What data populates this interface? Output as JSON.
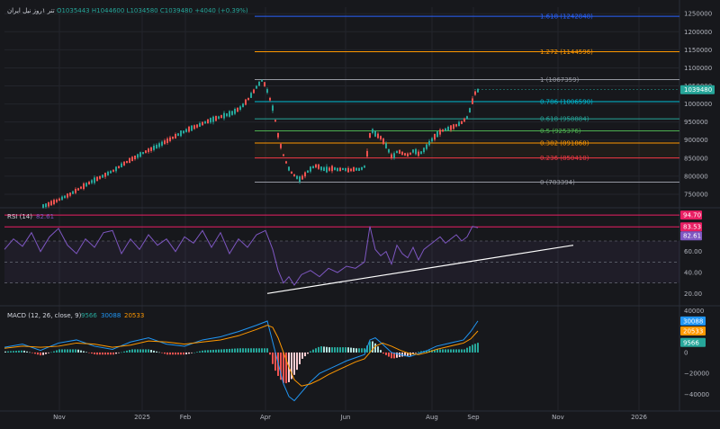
{
  "header": {
    "symbol": "تتر ۱روز نیل ایران",
    "o": "O1035443",
    "h": "H1044600",
    "l": "L1034580",
    "c": "C1039480",
    "chg": "+4040 (+0.39%)"
  },
  "colors": {
    "bg": "#17181c",
    "grid": "#23252b",
    "up": "#26a69a",
    "down": "#ef5350",
    "rsi": "#7e57c2",
    "macd": "#2196f3",
    "signal": "#ff9800",
    "axis_text": "#b2b5be"
  },
  "chart_data": [
    {
      "type": "candlestick",
      "price_axis_ticks": [
        750000,
        800000,
        850000,
        900000,
        950000,
        1000000,
        1050000,
        1100000,
        1150000,
        1200000,
        1250000
      ],
      "price_axis_labels": [
        "750000",
        "800000",
        "850000",
        "900000",
        "950000",
        "1000000",
        "1050000",
        "1100000",
        "1150000",
        "1200000",
        "1250000"
      ],
      "ylim": [
        715000,
        1268000
      ],
      "last_price": 1039480,
      "last_price_label": "1039480",
      "fib_levels": [
        {
          "label": "1.618 (1242848)",
          "value": 1242848,
          "color": "#2962ff"
        },
        {
          "label": "1.272 (1144596)",
          "value": 1144596,
          "color": "#ff9800"
        },
        {
          "label": "1 (1067359)",
          "value": 1067359,
          "color": "#9598a1"
        },
        {
          "label": "0.786 (1006590)",
          "value": 1006590,
          "color": "#00bcd4"
        },
        {
          "label": "0.618 (958884)",
          "value": 958884,
          "color": "#26a69a"
        },
        {
          "label": "0.5 (925376)",
          "value": 925376,
          "color": "#4caf50"
        },
        {
          "label": "0.382 (891868)",
          "value": 891868,
          "color": "#ff9800"
        },
        {
          "label": "0.236 (850410)",
          "value": 850410,
          "color": "#f23645"
        },
        {
          "label": "0 (783394)",
          "value": 783394,
          "color": "#9598a1"
        }
      ],
      "x_ticks": [
        "Nov",
        "2025",
        "Feb",
        "Apr",
        "Jun",
        "Aug",
        "Sep",
        "Nov",
        "2026"
      ],
      "price_path": [
        [
          0,
          680000
        ],
        [
          12,
          690000
        ],
        [
          24,
          700000
        ],
        [
          36,
          712000
        ],
        [
          48,
          722000
        ],
        [
          60,
          735000
        ],
        [
          72,
          750000
        ],
        [
          84,
          768000
        ],
        [
          96,
          785000
        ],
        [
          108,
          800000
        ],
        [
          120,
          815000
        ],
        [
          132,
          835000
        ],
        [
          144,
          852000
        ],
        [
          156,
          868000
        ],
        [
          168,
          882000
        ],
        [
          180,
          898000
        ],
        [
          192,
          915000
        ],
        [
          204,
          930000
        ],
        [
          216,
          942000
        ],
        [
          228,
          955000
        ],
        [
          240,
          965000
        ],
        [
          252,
          975000
        ],
        [
          262,
          990000
        ],
        [
          272,
          1020000
        ],
        [
          280,
          1050000
        ],
        [
          286,
          1067000
        ],
        [
          292,
          1030000
        ],
        [
          298,
          980000
        ],
        [
          304,
          900000
        ],
        [
          310,
          850000
        ],
        [
          316,
          815000
        ],
        [
          322,
          800000
        ],
        [
          328,
          790000
        ],
        [
          334,
          808000
        ],
        [
          340,
          822000
        ],
        [
          346,
          830000
        ],
        [
          352,
          820000
        ],
        [
          358,
          818000
        ],
        [
          364,
          822000
        ],
        [
          370,
          818000
        ],
        [
          376,
          820000
        ],
        [
          382,
          816000
        ],
        [
          388,
          820000
        ],
        [
          394,
          818000
        ],
        [
          400,
          828000
        ],
        [
          406,
          930000
        ],
        [
          412,
          915000
        ],
        [
          418,
          905000
        ],
        [
          424,
          880000
        ],
        [
          430,
          850000
        ],
        [
          436,
          870000
        ],
        [
          442,
          862000
        ],
        [
          448,
          858000
        ],
        [
          454,
          872000
        ],
        [
          460,
          860000
        ],
        [
          466,
          875000
        ],
        [
          472,
          895000
        ],
        [
          478,
          912000
        ],
        [
          484,
          924000
        ],
        [
          490,
          930000
        ],
        [
          496,
          935000
        ],
        [
          502,
          942000
        ],
        [
          508,
          950000
        ],
        [
          514,
          965000
        ],
        [
          518,
          1000000
        ],
        [
          522,
          1030000
        ],
        [
          526,
          1039480
        ]
      ]
    },
    {
      "type": "line",
      "name": "RSI (14)",
      "name_value": "82.61",
      "ylim": [
        10,
        100
      ],
      "y_ticks": [
        20,
        40,
        60
      ],
      "y_tick_labels": [
        "20.00",
        "40.00",
        "60.00"
      ],
      "badges": [
        {
          "label": "94.70",
          "value": 94.7,
          "color": "#e91e63"
        },
        {
          "label": "83.53",
          "value": 83.53,
          "color": "#e91e63"
        },
        {
          "label": "82.61",
          "value": 82.61,
          "color": "#7e57c2"
        }
      ],
      "band_upper": 70,
      "band_mid": 50,
      "band_lower": 30,
      "values": [
        [
          0,
          62
        ],
        [
          10,
          72
        ],
        [
          20,
          65
        ],
        [
          30,
          78
        ],
        [
          40,
          60
        ],
        [
          50,
          74
        ],
        [
          60,
          82
        ],
        [
          70,
          66
        ],
        [
          80,
          58
        ],
        [
          90,
          72
        ],
        [
          100,
          64
        ],
        [
          110,
          78
        ],
        [
          120,
          80
        ],
        [
          130,
          58
        ],
        [
          140,
          72
        ],
        [
          150,
          62
        ],
        [
          160,
          76
        ],
        [
          170,
          66
        ],
        [
          180,
          72
        ],
        [
          190,
          60
        ],
        [
          200,
          74
        ],
        [
          210,
          68
        ],
        [
          220,
          80
        ],
        [
          230,
          64
        ],
        [
          240,
          78
        ],
        [
          250,
          58
        ],
        [
          260,
          72
        ],
        [
          270,
          64
        ],
        [
          280,
          76
        ],
        [
          290,
          80
        ],
        [
          298,
          62
        ],
        [
          304,
          42
        ],
        [
          310,
          30
        ],
        [
          316,
          36
        ],
        [
          322,
          28
        ],
        [
          330,
          38
        ],
        [
          340,
          42
        ],
        [
          350,
          36
        ],
        [
          360,
          44
        ],
        [
          370,
          40
        ],
        [
          380,
          46
        ],
        [
          390,
          44
        ],
        [
          400,
          50
        ],
        [
          406,
          84
        ],
        [
          412,
          62
        ],
        [
          418,
          56
        ],
        [
          424,
          60
        ],
        [
          430,
          48
        ],
        [
          436,
          66
        ],
        [
          442,
          58
        ],
        [
          448,
          54
        ],
        [
          454,
          64
        ],
        [
          460,
          52
        ],
        [
          466,
          62
        ],
        [
          472,
          66
        ],
        [
          478,
          70
        ],
        [
          484,
          74
        ],
        [
          490,
          68
        ],
        [
          496,
          72
        ],
        [
          502,
          76
        ],
        [
          508,
          70
        ],
        [
          514,
          74
        ],
        [
          520,
          84
        ],
        [
          526,
          82.61
        ]
      ],
      "trendline": [
        [
          292,
          20
        ],
        [
          632,
          66
        ]
      ]
    },
    {
      "type": "bar+line",
      "name": "MACD (12, 26, close, 9)",
      "name_values": [
        {
          "label": "9566",
          "color": "#26a69a"
        },
        {
          "label": "30088",
          "color": "#2196f3"
        },
        {
          "label": "20533",
          "color": "#ff9800"
        }
      ],
      "ylim": [
        -55000,
        42000
      ],
      "y_ticks": [
        -40000,
        -20000,
        0,
        20000,
        40000
      ],
      "y_tick_labels": [
        "−40000",
        "−20000",
        "0",
        "20000",
        "40000"
      ],
      "badges": [
        {
          "label": "30088",
          "value": 30088,
          "color": "#2196f3"
        },
        {
          "label": "20533",
          "value": 20533,
          "color": "#ff9800"
        },
        {
          "label": "9566",
          "value": 9566,
          "color": "#26a69a"
        }
      ],
      "macd": [
        [
          0,
          5000
        ],
        [
          20,
          8000
        ],
        [
          40,
          2000
        ],
        [
          60,
          9000
        ],
        [
          80,
          12000
        ],
        [
          100,
          6000
        ],
        [
          120,
          3000
        ],
        [
          140,
          10000
        ],
        [
          160,
          14000
        ],
        [
          180,
          8000
        ],
        [
          200,
          6000
        ],
        [
          220,
          12000
        ],
        [
          240,
          15000
        ],
        [
          260,
          20000
        ],
        [
          280,
          26000
        ],
        [
          292,
          30000
        ],
        [
          298,
          10000
        ],
        [
          304,
          -10000
        ],
        [
          310,
          -30000
        ],
        [
          316,
          -42000
        ],
        [
          322,
          -46000
        ],
        [
          330,
          -38000
        ],
        [
          340,
          -28000
        ],
        [
          350,
          -20000
        ],
        [
          360,
          -16000
        ],
        [
          370,
          -12000
        ],
        [
          380,
          -8000
        ],
        [
          390,
          -5000
        ],
        [
          400,
          -2000
        ],
        [
          406,
          12000
        ],
        [
          412,
          14000
        ],
        [
          420,
          8000
        ],
        [
          430,
          0
        ],
        [
          440,
          -2000
        ],
        [
          450,
          -4000
        ],
        [
          460,
          -1000
        ],
        [
          470,
          2000
        ],
        [
          480,
          6000
        ],
        [
          490,
          8000
        ],
        [
          500,
          10000
        ],
        [
          510,
          12000
        ],
        [
          518,
          20000
        ],
        [
          526,
          30088
        ]
      ],
      "signal": [
        [
          0,
          4000
        ],
        [
          20,
          6000
        ],
        [
          40,
          5000
        ],
        [
          60,
          6000
        ],
        [
          80,
          9000
        ],
        [
          100,
          8000
        ],
        [
          120,
          5000
        ],
        [
          140,
          7000
        ],
        [
          160,
          11000
        ],
        [
          180,
          10000
        ],
        [
          200,
          8000
        ],
        [
          220,
          10000
        ],
        [
          240,
          12000
        ],
        [
          260,
          16000
        ],
        [
          280,
          22000
        ],
        [
          292,
          26000
        ],
        [
          298,
          24000
        ],
        [
          304,
          14000
        ],
        [
          310,
          0
        ],
        [
          316,
          -14000
        ],
        [
          322,
          -26000
        ],
        [
          330,
          -32000
        ],
        [
          340,
          -30000
        ],
        [
          350,
          -26000
        ],
        [
          360,
          -21000
        ],
        [
          370,
          -17000
        ],
        [
          380,
          -13000
        ],
        [
          390,
          -9000
        ],
        [
          400,
          -6000
        ],
        [
          406,
          0
        ],
        [
          412,
          6000
        ],
        [
          420,
          9000
        ],
        [
          430,
          6000
        ],
        [
          440,
          2000
        ],
        [
          450,
          -1000
        ],
        [
          460,
          -2000
        ],
        [
          470,
          0
        ],
        [
          480,
          3000
        ],
        [
          490,
          5000
        ],
        [
          500,
          7000
        ],
        [
          510,
          9000
        ],
        [
          518,
          13000
        ],
        [
          526,
          20533
        ]
      ]
    }
  ]
}
